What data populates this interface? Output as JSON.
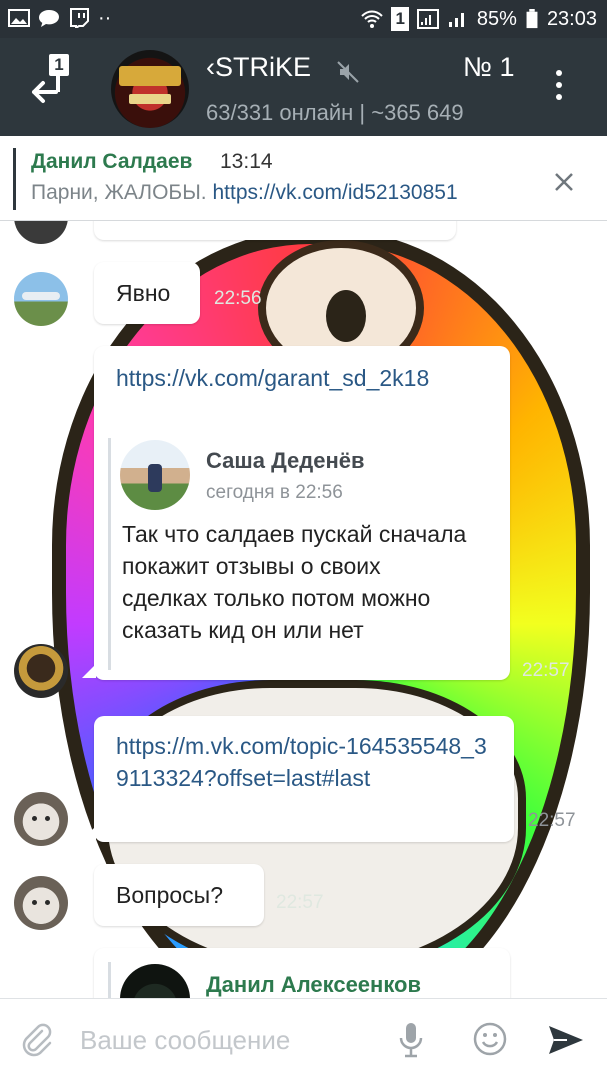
{
  "status_bar": {
    "battery": "85%",
    "time": "23:03",
    "sim_badge": "1"
  },
  "header": {
    "unread_count": "1",
    "title": "STRiKE",
    "title_suffix": "№ 1",
    "subtitle": "63/331 онлайн | ~365 649"
  },
  "pinned": {
    "author": "Данил Салдаев",
    "time": "13:14",
    "text_prefix": "Парни, ЖАЛОБЫ.",
    "link": "https://vk.com/id52130851"
  },
  "messages": [
    {
      "text": "Явно",
      "time": "22:56"
    },
    {
      "link": "https://vk.com/garant_sd_2k18",
      "quote": {
        "author": "Саша Деденёв",
        "date": "сегодня в 22:56",
        "text": "Так что салдаев пускай сначала покажит отзывы о своих сделках только потом можно сказать кид он или нет"
      },
      "time": "22:57"
    },
    {
      "link": "https://m.vk.com/topic-164535548_39113324?offset=last#last",
      "time": "22:57"
    },
    {
      "text": "Вопросы?",
      "time": "22:57"
    },
    {
      "quote_author": "Данил Алексеенков"
    }
  ],
  "input": {
    "placeholder": "Ваше сообщение"
  },
  "colors": {
    "header_bg": "#2e373d",
    "status_bg": "#2a3137",
    "link": "#2a5885",
    "pinned_author": "#2d7a4e"
  }
}
